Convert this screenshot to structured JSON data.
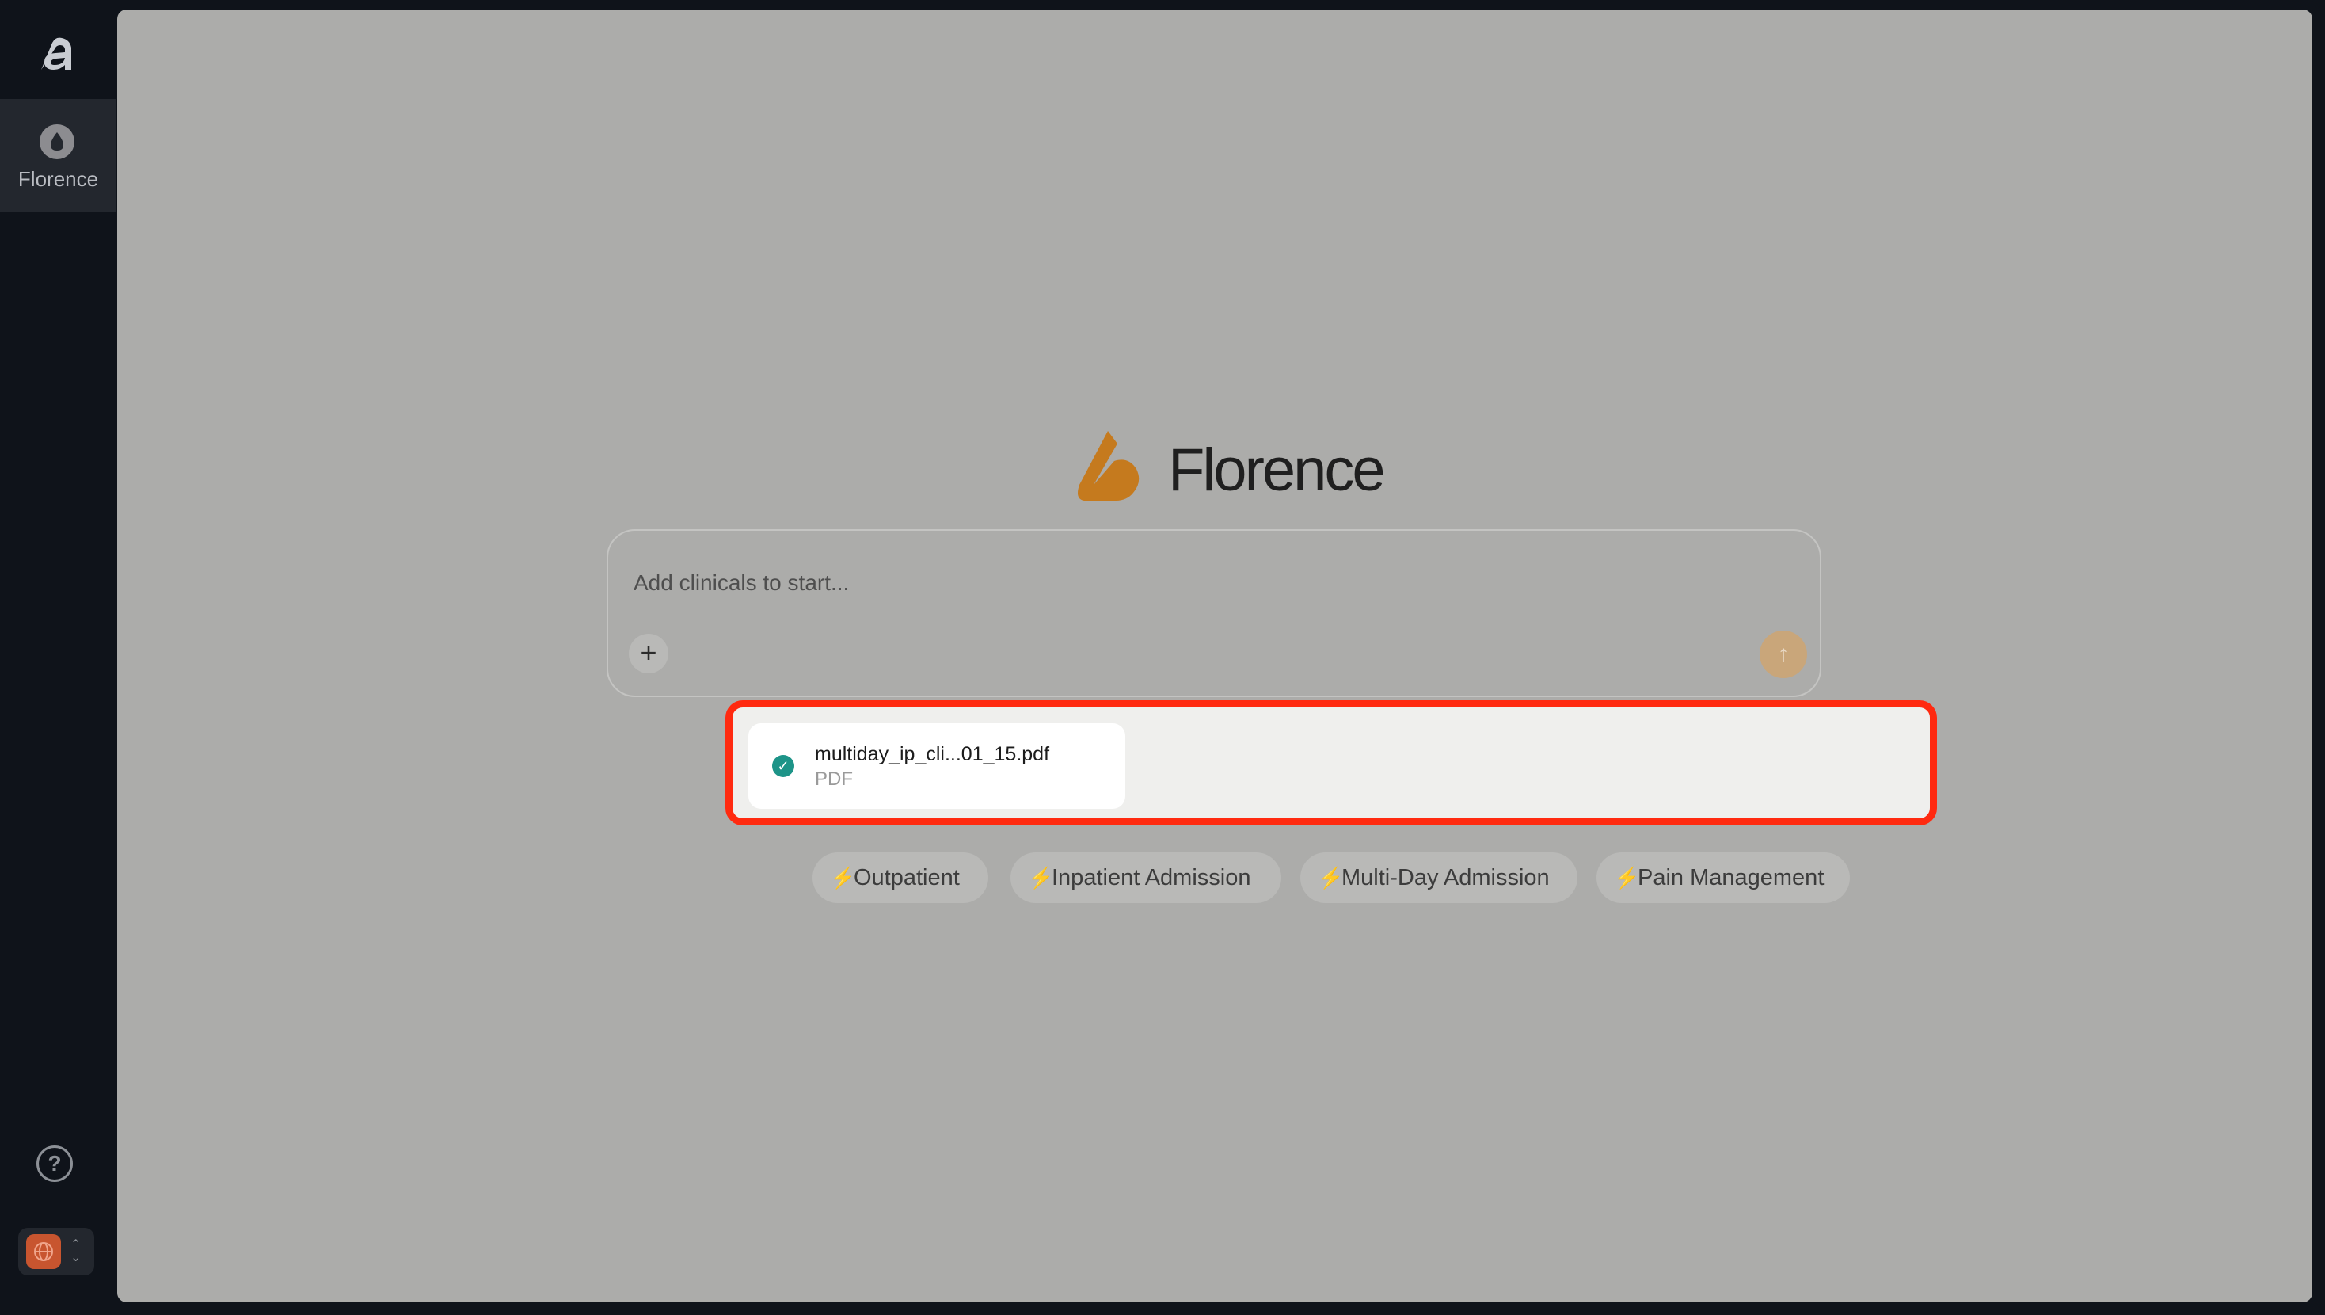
{
  "sidebar": {
    "brand_icon": "anterior-logo-icon",
    "nav_items": [
      {
        "label": "Florence",
        "icon": "drop-icon",
        "active": true
      }
    ],
    "help_icon": "question-circle-icon",
    "org_switcher_icon": "globe-icon"
  },
  "main": {
    "brand_title": "Florence",
    "brand_logo": "florence-logo-icon",
    "composer": {
      "placeholder": "Add clinicals to start...",
      "add_icon": "plus-icon",
      "send_icon": "arrow-up-icon"
    },
    "attachments": [
      {
        "name": "multiday_ip_cli...01_15.pdf",
        "type": "PDF",
        "status_icon": "check-circle-icon"
      }
    ],
    "quick_actions": [
      {
        "label": "Outpatient"
      },
      {
        "label": "Inpatient Admission"
      },
      {
        "label": "Multi-Day Admission"
      },
      {
        "label": "Pain Management"
      }
    ]
  },
  "colors": {
    "accent": "#c57a1e",
    "highlight": "#ff2a10",
    "success": "#1d9488",
    "sidebar_bg": "#0f131a"
  }
}
